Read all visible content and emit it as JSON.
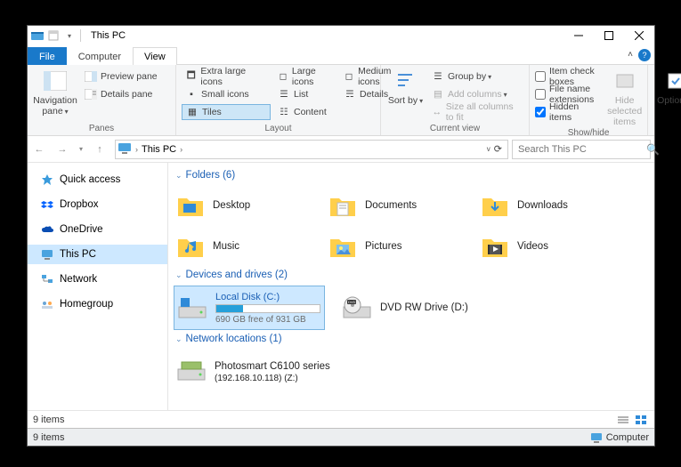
{
  "window": {
    "title": "This PC"
  },
  "tabs": {
    "file": "File",
    "computer": "Computer",
    "view": "View"
  },
  "ribbon": {
    "panes": {
      "label": "Panes",
      "navigation_pane": "Navigation pane",
      "preview_pane": "Preview pane",
      "details_pane": "Details pane"
    },
    "layout": {
      "label": "Layout",
      "xl": "Extra large icons",
      "large": "Large icons",
      "medium": "Medium icons",
      "small": "Small icons",
      "list": "List",
      "details": "Details",
      "tiles": "Tiles",
      "content": "Content"
    },
    "currentview": {
      "label": "Current view",
      "sort_by": "Sort by",
      "group_by": "Group by",
      "add_columns": "Add columns",
      "size_fit": "Size all columns to fit"
    },
    "showhide": {
      "label": "Show/hide",
      "item_check": "Item check boxes",
      "file_ext": "File name extensions",
      "hidden": "Hidden items",
      "hide_selected": "Hide selected items"
    },
    "options": "Options"
  },
  "address": {
    "location": "This PC",
    "search_placeholder": "Search This PC"
  },
  "sidebar": {
    "items": [
      {
        "key": "quickaccess",
        "label": "Quick access"
      },
      {
        "key": "dropbox",
        "label": "Dropbox"
      },
      {
        "key": "onedrive",
        "label": "OneDrive"
      },
      {
        "key": "thispc",
        "label": "This PC"
      },
      {
        "key": "network",
        "label": "Network"
      },
      {
        "key": "homegroup",
        "label": "Homegroup"
      }
    ]
  },
  "sections": {
    "folders": {
      "header": "Folders (6)",
      "items": [
        {
          "key": "desktop",
          "label": "Desktop"
        },
        {
          "key": "documents",
          "label": "Documents"
        },
        {
          "key": "downloads",
          "label": "Downloads"
        },
        {
          "key": "music",
          "label": "Music"
        },
        {
          "key": "pictures",
          "label": "Pictures"
        },
        {
          "key": "videos",
          "label": "Videos"
        }
      ]
    },
    "drives": {
      "header": "Devices and drives (2)",
      "items": [
        {
          "key": "c",
          "name": "Local Disk (C:)",
          "free": "690 GB free of 931 GB",
          "fill_pct": 26
        },
        {
          "key": "dvd",
          "name": "DVD RW Drive (D:)"
        }
      ]
    },
    "network": {
      "header": "Network locations (1)",
      "items": [
        {
          "key": "z",
          "name": "Photosmart C6100 series",
          "sub": "(192.168.10.118) (Z:)"
        }
      ]
    }
  },
  "status": {
    "left": "9 items"
  },
  "taskbar": {
    "left": "9 items",
    "right": "Computer"
  }
}
